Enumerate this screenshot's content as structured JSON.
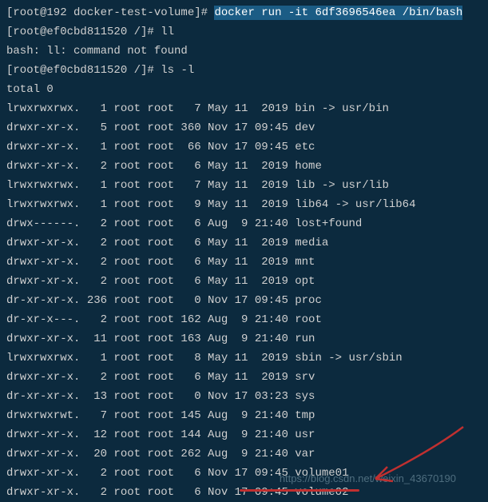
{
  "lines": {
    "l0_prompt": "[root@192 docker-test-volume]# ",
    "l0_cmd": "docker run -it 6df3696546ea /bin/bash",
    "l1_prompt": "[root@ef0cbd811520 /]# ",
    "l1_cmd": "ll",
    "l2": "bash: ll: command not found",
    "l3_prompt": "[root@ef0cbd811520 /]# ",
    "l3_cmd": "ls -l",
    "l4": "total 0"
  },
  "listing": [
    {
      "perm": "lrwxrwxrwx.",
      "n": "1",
      "o": "root",
      "g": "root",
      "s": "7",
      "m": "May",
      "d": "11",
      "t": "2019",
      "name": "bin -> usr/bin"
    },
    {
      "perm": "drwxr-xr-x.",
      "n": "5",
      "o": "root",
      "g": "root",
      "s": "360",
      "m": "Nov",
      "d": "17",
      "t": "09:45",
      "name": "dev"
    },
    {
      "perm": "drwxr-xr-x.",
      "n": "1",
      "o": "root",
      "g": "root",
      "s": "66",
      "m": "Nov",
      "d": "17",
      "t": "09:45",
      "name": "etc"
    },
    {
      "perm": "drwxr-xr-x.",
      "n": "2",
      "o": "root",
      "g": "root",
      "s": "6",
      "m": "May",
      "d": "11",
      "t": "2019",
      "name": "home"
    },
    {
      "perm": "lrwxrwxrwx.",
      "n": "1",
      "o": "root",
      "g": "root",
      "s": "7",
      "m": "May",
      "d": "11",
      "t": "2019",
      "name": "lib -> usr/lib"
    },
    {
      "perm": "lrwxrwxrwx.",
      "n": "1",
      "o": "root",
      "g": "root",
      "s": "9",
      "m": "May",
      "d": "11",
      "t": "2019",
      "name": "lib64 -> usr/lib64"
    },
    {
      "perm": "drwx------.",
      "n": "2",
      "o": "root",
      "g": "root",
      "s": "6",
      "m": "Aug",
      "d": "9",
      "t": "21:40",
      "name": "lost+found"
    },
    {
      "perm": "drwxr-xr-x.",
      "n": "2",
      "o": "root",
      "g": "root",
      "s": "6",
      "m": "May",
      "d": "11",
      "t": "2019",
      "name": "media"
    },
    {
      "perm": "drwxr-xr-x.",
      "n": "2",
      "o": "root",
      "g": "root",
      "s": "6",
      "m": "May",
      "d": "11",
      "t": "2019",
      "name": "mnt"
    },
    {
      "perm": "drwxr-xr-x.",
      "n": "2",
      "o": "root",
      "g": "root",
      "s": "6",
      "m": "May",
      "d": "11",
      "t": "2019",
      "name": "opt"
    },
    {
      "perm": "dr-xr-xr-x.",
      "n": "236",
      "o": "root",
      "g": "root",
      "s": "0",
      "m": "Nov",
      "d": "17",
      "t": "09:45",
      "name": "proc"
    },
    {
      "perm": "dr-xr-x---.",
      "n": "2",
      "o": "root",
      "g": "root",
      "s": "162",
      "m": "Aug",
      "d": "9",
      "t": "21:40",
      "name": "root"
    },
    {
      "perm": "drwxr-xr-x.",
      "n": "11",
      "o": "root",
      "g": "root",
      "s": "163",
      "m": "Aug",
      "d": "9",
      "t": "21:40",
      "name": "run"
    },
    {
      "perm": "lrwxrwxrwx.",
      "n": "1",
      "o": "root",
      "g": "root",
      "s": "8",
      "m": "May",
      "d": "11",
      "t": "2019",
      "name": "sbin -> usr/sbin"
    },
    {
      "perm": "drwxr-xr-x.",
      "n": "2",
      "o": "root",
      "g": "root",
      "s": "6",
      "m": "May",
      "d": "11",
      "t": "2019",
      "name": "srv"
    },
    {
      "perm": "dr-xr-xr-x.",
      "n": "13",
      "o": "root",
      "g": "root",
      "s": "0",
      "m": "Nov",
      "d": "17",
      "t": "03:23",
      "name": "sys"
    },
    {
      "perm": "drwxrwxrwt.",
      "n": "7",
      "o": "root",
      "g": "root",
      "s": "145",
      "m": "Aug",
      "d": "9",
      "t": "21:40",
      "name": "tmp"
    },
    {
      "perm": "drwxr-xr-x.",
      "n": "12",
      "o": "root",
      "g": "root",
      "s": "144",
      "m": "Aug",
      "d": "9",
      "t": "21:40",
      "name": "usr"
    },
    {
      "perm": "drwxr-xr-x.",
      "n": "20",
      "o": "root",
      "g": "root",
      "s": "262",
      "m": "Aug",
      "d": "9",
      "t": "21:40",
      "name": "var"
    },
    {
      "perm": "drwxr-xr-x.",
      "n": "2",
      "o": "root",
      "g": "root",
      "s": "6",
      "m": "Nov",
      "d": "17",
      "t": "09:45",
      "name": "volume01"
    },
    {
      "perm": "drwxr-xr-x.",
      "n": "2",
      "o": "root",
      "g": "root",
      "s": "6",
      "m": "Nov",
      "d": "17",
      "t": "09:45",
      "name": "volume02"
    }
  ],
  "watermark": "https://blog.csdn.net/weixin_43670190"
}
